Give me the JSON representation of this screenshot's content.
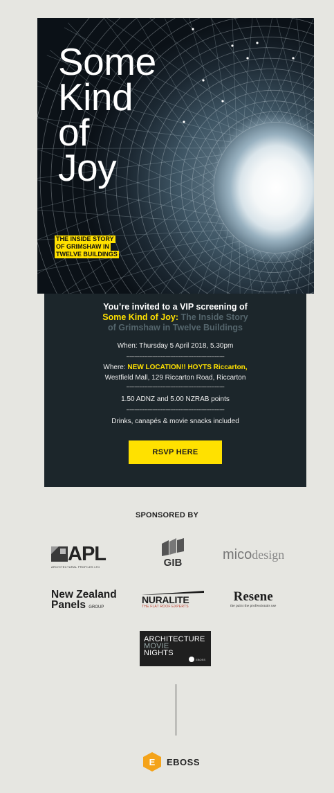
{
  "hero": {
    "title_lines": [
      "Some",
      "Kind",
      "of",
      "Joy"
    ],
    "subtitle_lines": [
      "THE INSIDE STORY",
      "OF GRIMSHAW IN",
      "TWELVE BUILDINGS"
    ]
  },
  "invite": {
    "heading_line1": "You’re invited to a VIP screening of",
    "film_title": "Some Kind of Joy:",
    "film_subtitle_a": "The Inside Story",
    "film_subtitle_b": "of Grimshaw in Twelve Buildings",
    "when": "When: Thursday 5 April 2018, 5.30pm",
    "where_prefix": "Where: ",
    "where_highlight": "NEW LOCATION!! HOYTS Riccarton,",
    "where_address": "Westfield Mall, 129 Riccarton Road, Riccarton",
    "points": "1.50 ADNZ and 5.00 NZRAB points",
    "extras": "Drinks, canapés & movie snacks included",
    "divider": "------------------------------------------------------------",
    "rsvp_label": "RSVP HERE"
  },
  "sponsors": {
    "heading": "SPONSORED BY",
    "apl": {
      "name": "APL",
      "tagline": "ARCHITECTURAL PROFILES LTD"
    },
    "gib": {
      "name": "GIB"
    },
    "mico": {
      "part1": "mico",
      "part2": "design"
    },
    "nzp": {
      "line1": "New Zealand",
      "line2": "Panels",
      "group": "GROUP"
    },
    "nuralite": {
      "name": "NURALITE",
      "tagline": "THE FLAT ROOF EXPERTS"
    },
    "resene": {
      "name": "Resene",
      "tagline": "the paint the professionals use"
    },
    "amn": {
      "line1": "ARCHITECTURE",
      "line2": "MOVIE",
      "line3": "NIGHTS",
      "badge": "EBOSS"
    }
  },
  "footer": {
    "brand": "EBOSS",
    "icon_letter": "E"
  },
  "colors": {
    "accent_yellow": "#ffe100",
    "panel": "#1c262b",
    "background": "#e6e6e1",
    "eboss_orange": "#f4a31a"
  }
}
